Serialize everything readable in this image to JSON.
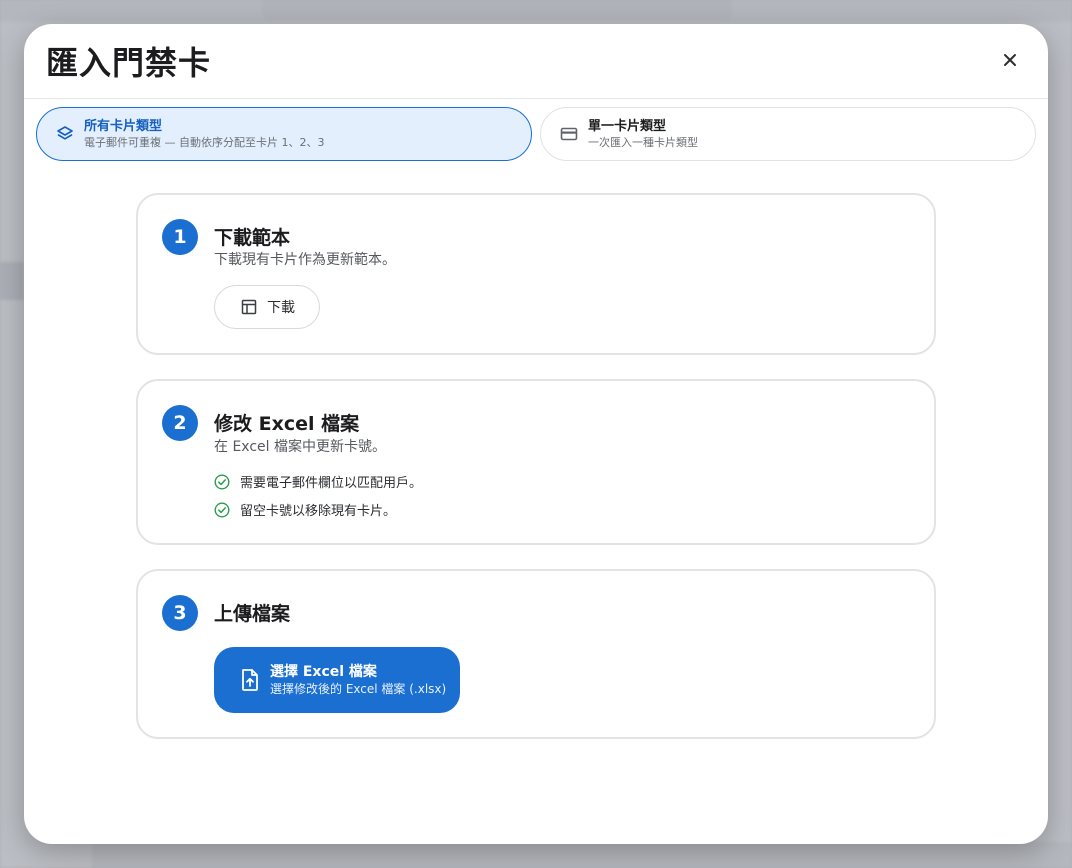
{
  "dialog": {
    "title": "匯入門禁卡",
    "close_icon": "close-icon"
  },
  "tabs": [
    {
      "label": "所有卡片類型",
      "sub": "電子郵件可重複 — 自動依序分配至卡片 1、2、3",
      "icon": "layers-icon",
      "active": true
    },
    {
      "label": "單一卡片類型",
      "sub": "一次匯入一種卡片類型",
      "icon": "credit-card-icon",
      "active": false
    }
  ],
  "steps": [
    {
      "number": "1",
      "title": "下載範本",
      "desc": "下載現有卡片作為更新範本。",
      "button_label": "下載",
      "button_icon": "table-icon"
    },
    {
      "number": "2",
      "title": "修改 Excel 檔案",
      "desc": "在 Excel 檔案中更新卡號。",
      "checks": [
        "需要電子郵件欄位以匹配用戶。",
        "留空卡號以移除現有卡片。"
      ]
    },
    {
      "number": "3",
      "title": "上傳檔案",
      "button_label": "選擇 Excel 檔案",
      "button_sub": "選擇修改後的 Excel 檔案 (.xlsx)",
      "button_icon": "file-upload-icon"
    }
  ],
  "colors": {
    "accent": "#1a6fd1",
    "active_tab_bg": "#e3effc",
    "check": "#2e9b4f"
  }
}
